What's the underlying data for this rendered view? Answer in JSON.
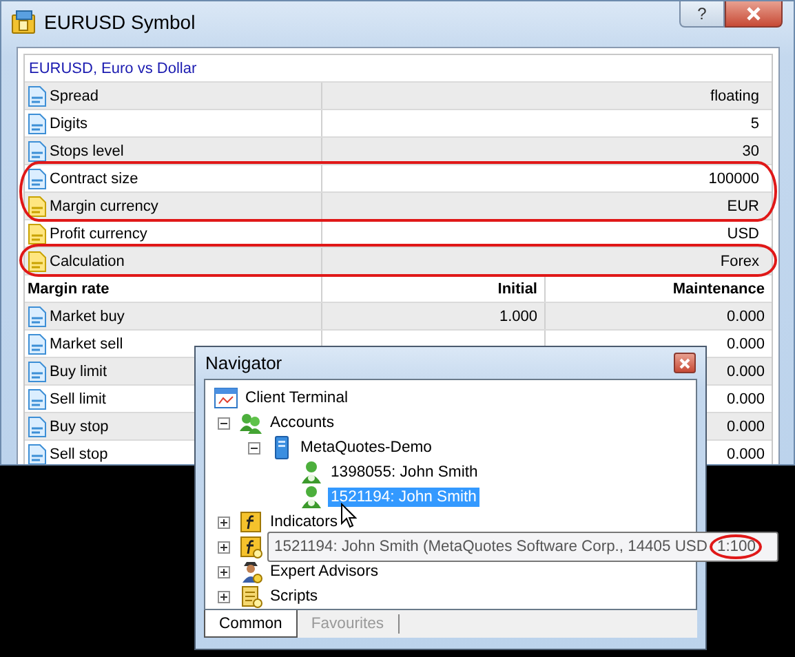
{
  "symbol": {
    "title": "EURUSD Symbol",
    "help": "?",
    "heading": "EURUSD, Euro vs  Dollar",
    "properties": [
      {
        "kind": "number",
        "name": "Spread",
        "value": "floating",
        "circled": false
      },
      {
        "kind": "number",
        "name": "Digits",
        "value": "5",
        "circled": false
      },
      {
        "kind": "number",
        "name": "Stops level",
        "value": "30",
        "circled": false
      },
      {
        "kind": "number",
        "name": "Contract size",
        "value": "100000",
        "circled": true
      },
      {
        "kind": "text",
        "name": "Margin currency",
        "value": "EUR",
        "circled": true
      },
      {
        "kind": "text",
        "name": "Profit currency",
        "value": "USD",
        "circled": false
      },
      {
        "kind": "text",
        "name": "Calculation",
        "value": "Forex",
        "circled": true
      }
    ],
    "margin_header": {
      "name": "Margin rate",
      "initial": "Initial",
      "maintenance": "Maintenance"
    },
    "margin_rows": [
      {
        "name": "Market buy",
        "initial": "1.000",
        "maintenance": "0.000"
      },
      {
        "name": "Market sell",
        "maintenance": "0.000"
      },
      {
        "name": "Buy limit",
        "maintenance": "0.000"
      },
      {
        "name": "Sell limit",
        "maintenance": "0.000"
      },
      {
        "name": "Buy stop",
        "maintenance": "0.000"
      },
      {
        "name": "Sell stop",
        "maintenance": "0.000"
      }
    ]
  },
  "navigator": {
    "title": "Navigator",
    "tree": [
      {
        "label": "Client Terminal",
        "kind": "terminal",
        "selected": false,
        "children": [
          {
            "label": "Accounts",
            "kind": "accounts",
            "expanded": true,
            "selected": false,
            "children": [
              {
                "label": "MetaQuotes-Demo",
                "kind": "server",
                "expanded": true,
                "selected": false,
                "children": [
                  {
                    "label": "1398055: John Smith",
                    "kind": "user",
                    "selected": false
                  },
                  {
                    "label": "1521194: John Smith",
                    "kind": "user",
                    "selected": true
                  }
                ]
              }
            ]
          },
          {
            "label": "Indicators",
            "kind": "indicator",
            "expanded": false,
            "selected": false
          },
          {
            "kind": "custom_indicator",
            "expanded": false,
            "selected": false
          },
          {
            "label": "Expert Advisors",
            "kind": "expert",
            "expanded": false,
            "selected": false
          },
          {
            "label": "Scripts",
            "kind": "script",
            "expanded": false,
            "selected": false
          }
        ]
      }
    ],
    "tabs": [
      {
        "label": "Common",
        "selected": true
      },
      {
        "label": "Favourites",
        "selected": false
      }
    ]
  },
  "tooltip": {
    "text": "1521194: John Smith (MetaQuotes Software Corp., 14405 USD",
    "circled_text": "1:100",
    "circled": true
  }
}
